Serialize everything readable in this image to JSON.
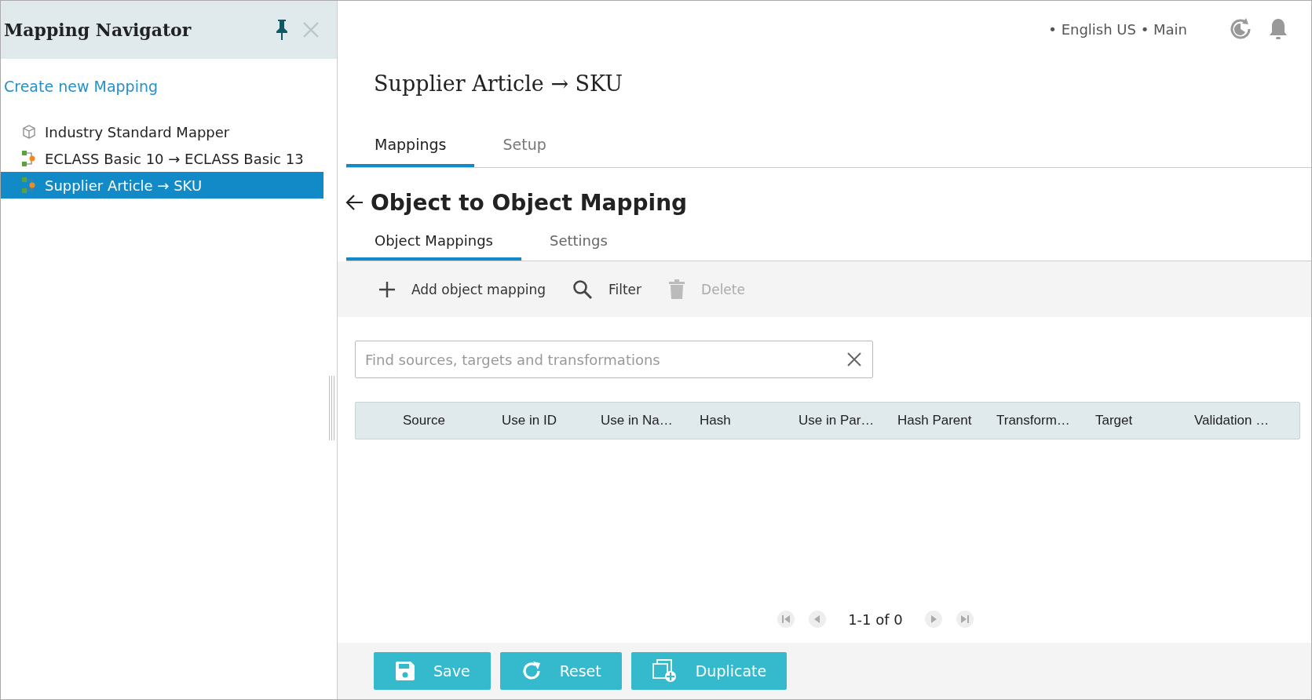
{
  "sidebar": {
    "title": "Mapping Navigator",
    "create_link": "Create new Mapping",
    "items": [
      {
        "kind": "standard",
        "label": "Industry Standard Mapper",
        "selected": false
      },
      {
        "kind": "mapping",
        "label": "ECLASS Basic 10 → ECLASS Basic 13",
        "selected": false
      },
      {
        "kind": "mapping",
        "label": "Supplier Article → SKU",
        "selected": true
      }
    ]
  },
  "header": {
    "context": "• English US • Main"
  },
  "page_title": "Supplier Article → SKU",
  "tabs": [
    {
      "label": "Mappings",
      "selected": true
    },
    {
      "label": "Setup",
      "selected": false
    }
  ],
  "section_title": "Object to Object Mapping",
  "subtabs": [
    {
      "label": "Object Mappings",
      "selected": true
    },
    {
      "label": "Settings",
      "selected": false
    }
  ],
  "toolbar": [
    {
      "kind": "add",
      "label": "Add object mapping",
      "disabled": false
    },
    {
      "kind": "filter",
      "label": "Filter",
      "disabled": false
    },
    {
      "kind": "delete",
      "label": "Delete",
      "disabled": true
    }
  ],
  "search": {
    "placeholder": "Find sources, targets and transformations"
  },
  "table": {
    "columns": [
      "Source",
      "Use in ID",
      "Use in Na…",
      "Hash",
      "Use in Par…",
      "Hash Parent",
      "Transform…",
      "Target",
      "Validation …"
    ]
  },
  "pagination": {
    "range": "1-1 of 0"
  },
  "buttons": [
    {
      "kind": "save",
      "label": "Save"
    },
    {
      "kind": "reset",
      "label": "Reset"
    },
    {
      "kind": "duplicate",
      "label": "Duplicate"
    }
  ]
}
